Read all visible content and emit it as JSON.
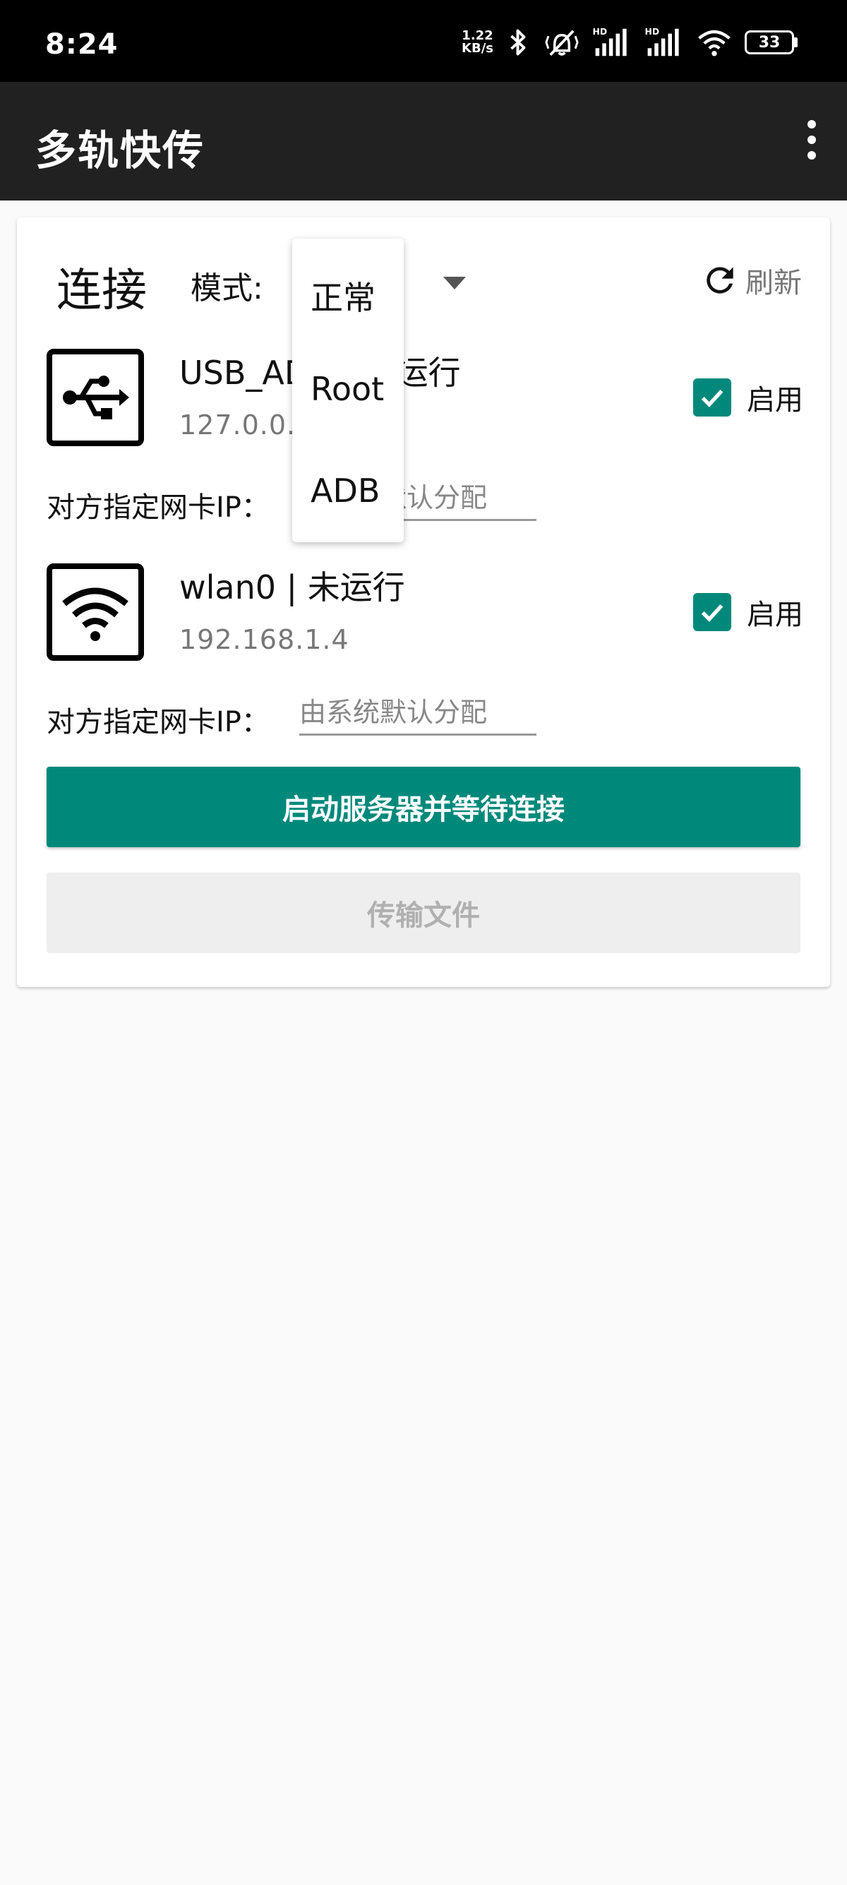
{
  "status_bar": {
    "time": "8:24",
    "net_speed_value": "1.22",
    "net_speed_unit": "KB/s",
    "hd1": "HD",
    "hd2": "HD",
    "battery": "33",
    "icons": [
      "bluetooth-icon",
      "vibrate-off-icon",
      "signal-1-icon",
      "signal-2-icon",
      "wifi-icon",
      "battery-icon"
    ]
  },
  "app_bar": {
    "title": "多轨快传",
    "menu_icon": "more-vert-icon"
  },
  "card": {
    "title": "连接",
    "mode_label": "模式:",
    "refresh_label": "刷新",
    "accent_color": "#00897b",
    "interfaces": [
      {
        "name": "USB_ADB | 未运行",
        "ip": "127.0.0.1",
        "icon": "usb-icon",
        "enabled": true,
        "enable_label": "启用",
        "peer_label": "对方指定网卡IP：",
        "peer_placeholder": "由系统默认分配"
      },
      {
        "name": "wlan0 | 未运行",
        "ip": "192.168.1.4",
        "icon": "wifi-icon",
        "enabled": true,
        "enable_label": "启用",
        "peer_label": "对方指定网卡IP：",
        "peer_placeholder": "由系统默认分配"
      }
    ],
    "start_button": "启动服务器并等待连接",
    "transfer_button": "传输文件"
  },
  "mode_dropdown": {
    "options": [
      "正常",
      "Root",
      "ADB"
    ]
  }
}
